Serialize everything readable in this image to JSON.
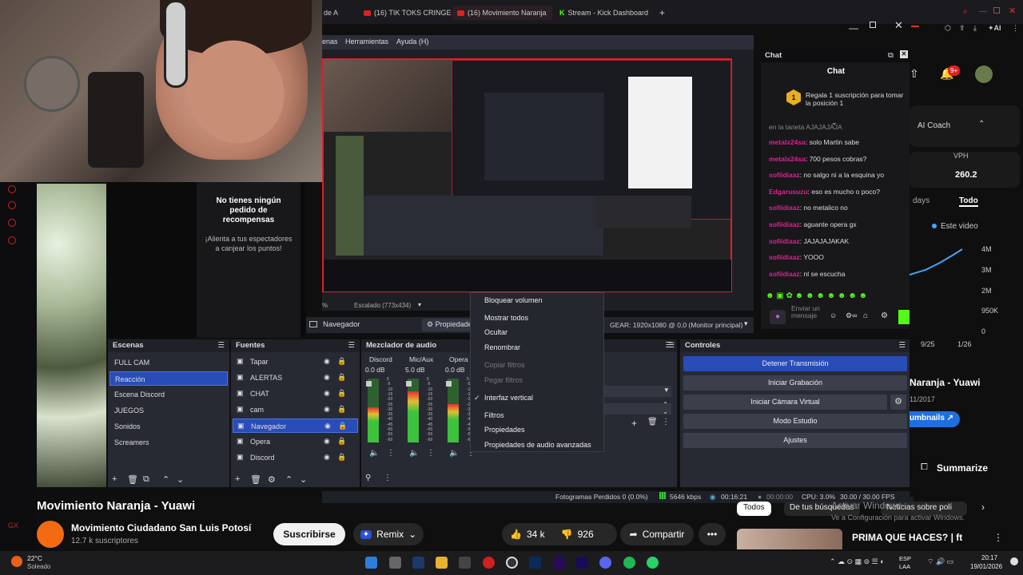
{
  "browser": {
    "tabs": [
      {
        "label": "de A"
      },
      {
        "label": "(16) TIK TOKS CRINGE"
      },
      {
        "label": "(16) Movimiento Naranja"
      },
      {
        "label": "Stream - Kick Dashboard"
      }
    ],
    "new_tab": "+",
    "ai_label": "AI"
  },
  "obs": {
    "menu": [
      "enas",
      "Herramientas",
      "Ayuda (H)"
    ],
    "toolbar": {
      "source_name": "Navegador",
      "props_label": "Propiedades",
      "gear_label": "GEAR: 1920x1080 @ 0,0 (Monitor principal)",
      "scaling": "Escalado (773x434)",
      "preview_pct": "%"
    },
    "scenes": {
      "title": "Escenas",
      "items": [
        "FULL CAM",
        "Reacción",
        "Escena Discord",
        "JUEGOS",
        "Sonidos",
        "Screamers"
      ],
      "selected": 1
    },
    "sources": {
      "title": "Fuentes",
      "items": [
        "Tapar",
        "ALERTAS",
        "CHAT",
        "cam",
        "Navegador",
        "Opera",
        "Discord"
      ],
      "selected": 4
    },
    "mixer": {
      "title": "Mezclador de audio",
      "channels": [
        {
          "name": "Discord",
          "db": "0.0 dB",
          "level": 0.55
        },
        {
          "name": "Mic/Aux",
          "db": "5.0 dB",
          "level": 0.8
        },
        {
          "name": "Opera",
          "db": "0.0 dB",
          "level": 0.6
        }
      ],
      "scale": [
        "0",
        "-5",
        "-10",
        "-15",
        "-20",
        "-25",
        "-30",
        "-35",
        "-40",
        "-45",
        "-50",
        "-55",
        "-60"
      ]
    },
    "context_menu": [
      {
        "label": "Bloquear volumen",
        "enabled": true,
        "checked": false
      },
      {
        "label": "Mostrar todos",
        "enabled": true,
        "checked": false
      },
      {
        "label": "Ocultar",
        "enabled": true,
        "checked": false
      },
      {
        "label": "Renombrar",
        "enabled": true,
        "checked": false
      },
      {
        "label": "Copiar filtros",
        "enabled": false,
        "checked": false
      },
      {
        "label": "Pegar filtros",
        "enabled": false,
        "checked": false
      },
      {
        "label": "Interfaz vertical",
        "enabled": true,
        "checked": true
      },
      {
        "label": "Filtros",
        "enabled": true,
        "checked": false
      },
      {
        "label": "Propiedades",
        "enabled": true,
        "checked": false
      },
      {
        "label": "Propiedades de audio avanzadas",
        "enabled": true,
        "checked": false
      }
    ],
    "controls": {
      "title": "Controles",
      "buttons": [
        "Detener Transmisión",
        "Iniciar Grabación",
        "Iniciar Cámara Virtual",
        "Modo Estudio",
        "Ajustes"
      ]
    },
    "status": {
      "dropped": "Fotogramas Perdidos 0 (0.0%)",
      "bitrate": "5646 kbps",
      "live_time": "00:16:21",
      "rec_time": "00:00:00",
      "cpu": "CPU: 3.0%",
      "fps": "30.00 / 30.00 FPS"
    }
  },
  "rewards": {
    "title": "No tienes ningún pedido de recompensas",
    "subtitle": "¡Alienta a tus espectadores a canjear los puntos!"
  },
  "chat": {
    "window_title": "Chat",
    "header": "Chat",
    "sub_notice": "Regala 1 suscripción para tomar la posición 1",
    "sub_rank": "1",
    "cutoff_text": "en la tarjeta AJAJAJAJA",
    "messages": [
      {
        "user": "metalx24sa",
        "text": "solo Martin sabe"
      },
      {
        "user": "metalx24sa",
        "text": "700 pesos cobras?"
      },
      {
        "user": "sofiidiaaz",
        "text": "no salgo ni a la esquina yo"
      },
      {
        "user": "Edgarusuzu",
        "text": "eso es mucho o poco?"
      },
      {
        "user": "sofiidiaaz",
        "text": "no metalico no"
      },
      {
        "user": "sofiidiaaz",
        "text": "aguante opera gx"
      },
      {
        "user": "sofiidiaaz",
        "text": "JAJAJAJAKAK"
      },
      {
        "user": "sofiidiaaz",
        "text": "YOOO"
      },
      {
        "user": "sofiidiaaz",
        "text": "nl se escucha"
      }
    ],
    "input_placeholder": "Enviar un mensaje"
  },
  "yt_side": {
    "notif_count": "9+",
    "ai_coach": "AI Coach",
    "vph_label": "VPH",
    "vph_value": "260.2",
    "tabs": [
      "days",
      "Todo"
    ],
    "legend": "Este video",
    "y_ticks": [
      "4M",
      "3M",
      "2M",
      "950K",
      "0"
    ],
    "x_ticks": [
      "9/25",
      "1/26"
    ],
    "video_title": "Naranja - Yuawi",
    "date": "11/2017",
    "thumbnails_btn": "umbnails",
    "summarize": "Summarize"
  },
  "yt_bottom": {
    "video_title": "Movimiento Naranja - Yuawi",
    "channel_name": "Movimiento Ciudadano San Luis Potosí",
    "subscribers": "12.7 k suscriptores",
    "subscribe": "Suscribirse",
    "remix": "Remix",
    "likes": "34 k",
    "dislikes": "926",
    "share": "Compartir",
    "more": "•••",
    "chips": [
      "Todos",
      "De tus búsquedas",
      "Noticias sobre polí"
    ],
    "next_title": "PRIMA QUE HACES? | ft",
    "windows_activate": "Activar Windows",
    "windows_activate_sub": "Ve a Configuración para activar Windows."
  },
  "taskbar": {
    "temp": "22°C",
    "weather": "Soleado",
    "lang": "ESP",
    "lang2": "LAA",
    "time": "20:17",
    "date": "19/01/2026"
  },
  "colors": {
    "obs_selected": "#284cb8",
    "live_border": "#e01e2e",
    "chat_user": "#e02090",
    "kick_green": "#53fc18"
  }
}
